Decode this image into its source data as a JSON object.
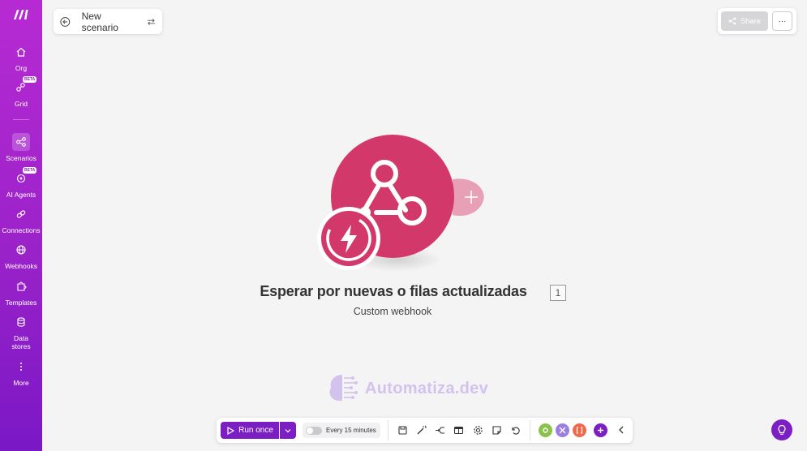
{
  "sidebar": {
    "items": [
      {
        "label": "Org",
        "icon": "home-icon"
      },
      {
        "label": "Grid",
        "icon": "grid-icon",
        "badge": "BETA"
      },
      {
        "label": "Scenarios",
        "icon": "scenarios-icon"
      },
      {
        "label": "AI Agents",
        "icon": "ai-agents-icon",
        "badge": "BETA"
      },
      {
        "label": "Connections",
        "icon": "link-icon"
      },
      {
        "label": "Webhooks",
        "icon": "globe-icon"
      },
      {
        "label": "Templates",
        "icon": "puzzle-icon"
      },
      {
        "label": "Data stores",
        "icon": "database-icon"
      },
      {
        "label": "More",
        "icon": "more-vertical-icon"
      }
    ]
  },
  "header": {
    "title": "New scenario"
  },
  "topright": {
    "share_label": "Share",
    "more_label": "···"
  },
  "module": {
    "title": "Esperar por nuevas o filas actualizadas",
    "subtitle": "Custom webhook",
    "id": "1"
  },
  "watermark": {
    "text": "Automatiza.dev"
  },
  "toolbar": {
    "run_label": "Run once",
    "schedule_label": "Every 15 minutes"
  },
  "colors": {
    "sidebar_top": "#b72ad3",
    "sidebar_bottom": "#7a18c6",
    "accent": "#7b1ec3",
    "module": "#d2386a"
  }
}
